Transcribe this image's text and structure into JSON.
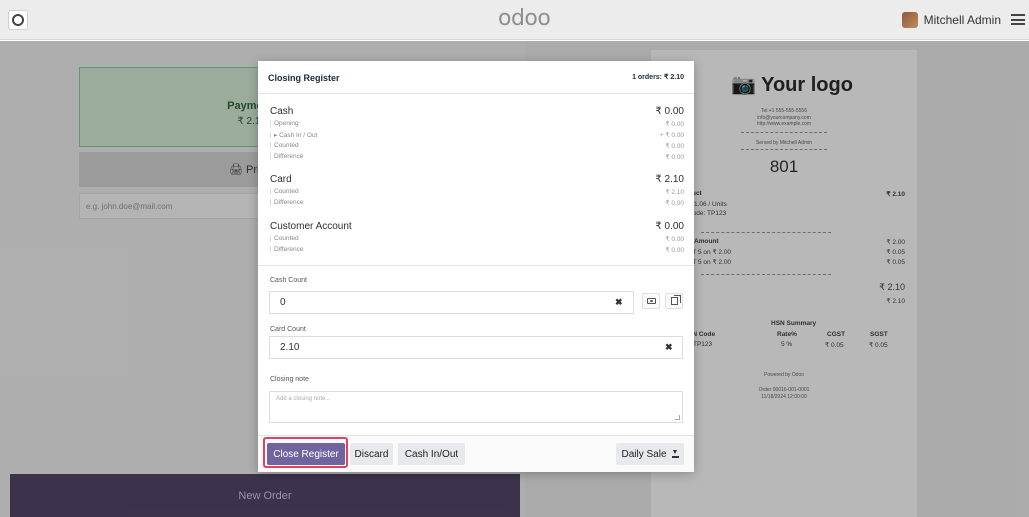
{
  "topbar": {
    "logo": "odoo",
    "user_name": "Mitchell Admin"
  },
  "background": {
    "payment_label": "Payment",
    "payment_amount": "₹ 2.10",
    "print_label": "🖨 Print R",
    "email_placeholder": "e.g. john.doe@mail.com",
    "new_order": "New Order"
  },
  "receipt": {
    "logo": "📷 Your logo",
    "tel": "Tel:+1 555-555-5556",
    "email": "info@yourcompany.com",
    "website": "http://www.example.com",
    "served_by": "Served by Mitchell Admin",
    "order_number": "801",
    "product": "duct",
    "product_amount": "₹ 2.10",
    "unit_price": "₹ 1.06 / Units",
    "code": "Code: TP123",
    "amount_label": "Amount",
    "amount_value": "₹ 2.00",
    "tax_line_1": "ST 5 on ₹ 2.00",
    "tax_value_1": "₹ 0.05",
    "tax_line_2": "ST 5 on ₹ 2.00",
    "tax_value_2": "₹ 0.05",
    "total": "₹ 2.10",
    "total_sub": "₹ 2.10",
    "hsn_title": "HSN Summary",
    "hsn_headers": [
      "SN Code",
      "Rate%",
      "CGST",
      "SGST"
    ],
    "hsn_row": [
      "TP123",
      "5 %",
      "₹ 0.05",
      "₹ 0.05"
    ],
    "powered": "Powered by Odoo",
    "order_ref": "Order 00016-001-0001",
    "order_date": "11/18/2024 12:00:00"
  },
  "dialog": {
    "title": "Closing Register",
    "orders": "1 orders: ₹ 2.10",
    "cash": {
      "title": "Cash",
      "total": "₹ 0.00",
      "rows": [
        {
          "label": "Opening",
          "value": "₹ 0.00"
        },
        {
          "label": "▸ Cash In / Out",
          "value": "+ ₹ 0.00"
        },
        {
          "label": "Counted",
          "value": "₹ 0.00"
        },
        {
          "label": "Difference",
          "value": "₹ 0.00"
        }
      ]
    },
    "card": {
      "title": "Card",
      "total": "₹ 2.10",
      "rows": [
        {
          "label": "Counted",
          "value": "₹ 2.10"
        },
        {
          "label": "Difference",
          "value": "₹ 0.00"
        }
      ]
    },
    "customer_account": {
      "title": "Customer Account",
      "total": "₹ 0.00",
      "rows": [
        {
          "label": "Counted",
          "value": "₹ 0.00"
        },
        {
          "label": "Difference",
          "value": "₹ 0.00"
        }
      ]
    },
    "cash_count": {
      "label": "Cash Count",
      "value": "0"
    },
    "card_count": {
      "label": "Card Count",
      "value": "2.10"
    },
    "closing_note": {
      "label": "Closing note",
      "placeholder": "Add a closing note..."
    },
    "buttons": {
      "close_register": "Close Register",
      "discard": "Discard",
      "cash_in_out": "Cash In/Out",
      "daily_sale": "Daily Sale"
    },
    "clear_symbol": "✖"
  },
  "colors": {
    "primary": "#71639e",
    "highlight": "#e0435e",
    "payment_bg": "#d7efd9",
    "new_order_bg": "#54466b"
  }
}
